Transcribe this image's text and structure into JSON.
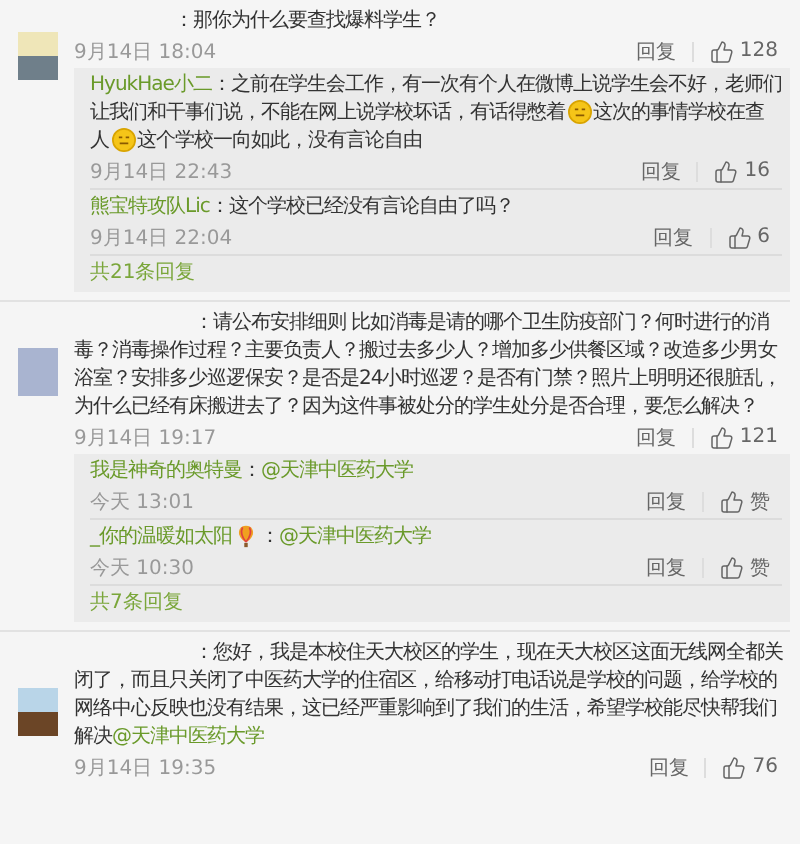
{
  "comments": [
    {
      "parts": [
        {
          "kind": "text",
          "text": "：那你为什么要查找爆料学生？"
        }
      ],
      "time": "9月14日 18:04",
      "reply": "回复",
      "likes": "128",
      "replies": {
        "items": [
          {
            "user": "HyukHae小二",
            "parts": [
              {
                "kind": "text",
                "text": "：之前在学生会工作，有一次有个人在微博上说学生会不好，老师们让我们和干事们说，不能在网上说学校坏话，有话得憋着"
              },
              {
                "kind": "emoji"
              },
              {
                "kind": "text",
                "text": "这次的事情学校在查人"
              },
              {
                "kind": "emoji"
              },
              {
                "kind": "text",
                "text": "这个学校一向如此，没有言论自由"
              }
            ],
            "time": "9月14日 22:43",
            "reply": "回复",
            "likes": "16"
          },
          {
            "user": "熊宝特攻队Lic",
            "parts": [
              {
                "kind": "text",
                "text": "：这个学校已经没有言论自由了吗？"
              }
            ],
            "time": "9月14日 22:04",
            "reply": "回复",
            "likes": "6"
          }
        ],
        "more": "共21条回复"
      }
    },
    {
      "parts": [
        {
          "kind": "text",
          "text": "：请公布安排细则 比如消毒是请的哪个卫生防疫部门？何时进行的消毒？消毒操作过程？主要负责人？搬过去多少人？增加多少供餐区域？改造多少男女浴室？安排多少巡逻保安？是否是24小时巡逻？是否有门禁？照片上明明还很脏乱，为什么已经有床搬进去了？因为这件事被处分的学生处分是否合理，要怎么解决？"
        }
      ],
      "time": "9月14日 19:17",
      "reply": "回复",
      "likes": "121",
      "replies": {
        "items": [
          {
            "user": "我是神奇的奥特曼",
            "parts": [
              {
                "kind": "text",
                "text": "："
              },
              {
                "kind": "mention",
                "text": "@天津中医药大学"
              }
            ],
            "time": "今天 13:01",
            "reply": "回复",
            "likes": "赞"
          },
          {
            "user": "_你的温暖如太阳",
            "parts": [
              {
                "kind": "balloon"
              },
              {
                "kind": "text",
                "text": "："
              },
              {
                "kind": "mention",
                "text": "@天津中医药大学"
              }
            ],
            "time": "今天 10:30",
            "reply": "回复",
            "likes": "赞"
          }
        ],
        "more": "共7条回复"
      }
    },
    {
      "parts": [
        {
          "kind": "text",
          "text": "：您好，我是本校住天大校区的学生，现在天大校区这面无线网全都关闭了，而且只关闭了中医药大学的住宿区，给移动打电话说是学校的问题，给学校的网络中心反映也没有结果，这已经严重影响到了我们的生活，希望学校能尽快帮我们解决"
        },
        {
          "kind": "mention",
          "text": "@天津中医药大学"
        }
      ],
      "time": "9月14日 19:35",
      "reply": "回复",
      "likes": "76"
    }
  ]
}
